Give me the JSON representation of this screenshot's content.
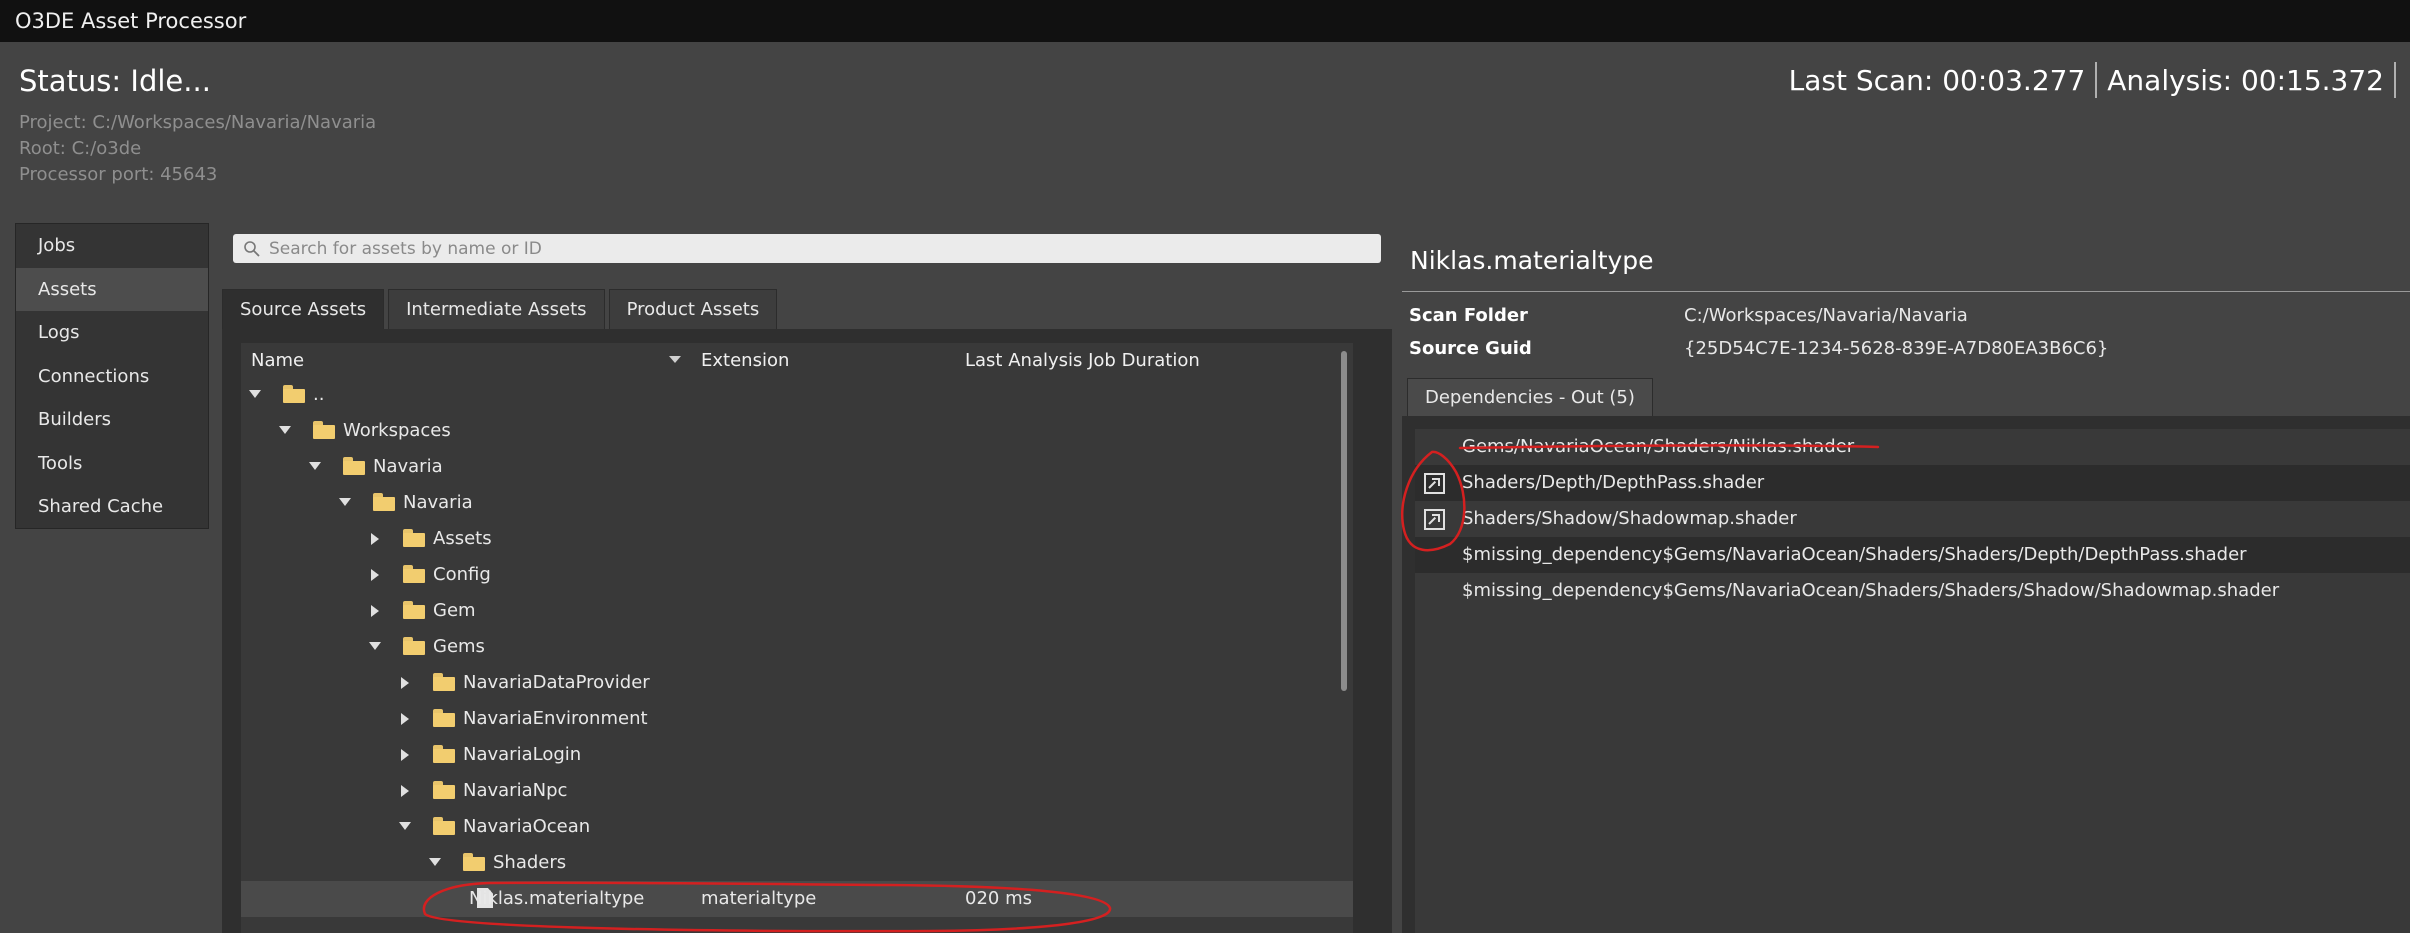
{
  "window": {
    "title": "O3DE Asset Processor"
  },
  "header": {
    "status": "Status: Idle...",
    "project": "Project: C:/Workspaces/Navaria/Navaria",
    "root": "Root: C:/o3de",
    "port": "Processor port: 45643",
    "last_scan": "Last Scan: 00:03.277",
    "analysis": "Analysis: 00:15.372"
  },
  "nav": {
    "items": [
      {
        "label": "Jobs"
      },
      {
        "label": "Assets"
      },
      {
        "label": "Logs"
      },
      {
        "label": "Connections"
      },
      {
        "label": "Builders"
      },
      {
        "label": "Tools"
      },
      {
        "label": "Shared Cache"
      }
    ],
    "active": "Assets"
  },
  "search": {
    "placeholder": "Search for assets by name or ID"
  },
  "tabs": [
    {
      "label": "Source Assets"
    },
    {
      "label": "Intermediate Assets"
    },
    {
      "label": "Product Assets"
    }
  ],
  "tree": {
    "columns": {
      "name": "Name",
      "extension": "Extension",
      "duration": "Last Analysis Job Duration"
    },
    "rows": [
      {
        "label": "..",
        "depth": 0,
        "expanded": true,
        "type": "folder"
      },
      {
        "label": "Workspaces",
        "depth": 1,
        "expanded": true,
        "type": "folder"
      },
      {
        "label": "Navaria",
        "depth": 2,
        "expanded": true,
        "type": "folder"
      },
      {
        "label": "Navaria",
        "depth": 3,
        "expanded": true,
        "type": "folder"
      },
      {
        "label": "Assets",
        "depth": 4,
        "expanded": false,
        "type": "folder"
      },
      {
        "label": "Config",
        "depth": 4,
        "expanded": false,
        "type": "folder"
      },
      {
        "label": "Gem",
        "depth": 4,
        "expanded": false,
        "type": "folder"
      },
      {
        "label": "Gems",
        "depth": 4,
        "expanded": true,
        "type": "folder"
      },
      {
        "label": "NavariaDataProvider",
        "depth": 5,
        "expanded": false,
        "type": "folder"
      },
      {
        "label": "NavariaEnvironment",
        "depth": 5,
        "expanded": false,
        "type": "folder"
      },
      {
        "label": "NavariaLogin",
        "depth": 5,
        "expanded": false,
        "type": "folder"
      },
      {
        "label": "NavariaNpc",
        "depth": 5,
        "expanded": false,
        "type": "folder"
      },
      {
        "label": "NavariaOcean",
        "depth": 5,
        "expanded": true,
        "type": "folder"
      },
      {
        "label": "Shaders",
        "depth": 6,
        "expanded": true,
        "type": "folder"
      },
      {
        "label": "Niklas.materialtype",
        "depth": 7,
        "type": "file",
        "extension": "materialtype",
        "duration": "020 ms",
        "selected": true
      }
    ]
  },
  "details": {
    "title": "Niklas.materialtype",
    "scan_folder_label": "Scan Folder",
    "scan_folder_value": "C:/Workspaces/Navaria/Navaria",
    "source_guid_label": "Source Guid",
    "source_guid_value": "{25D54C7E-1234-5628-839E-A7D80EA3B6C6}",
    "dependencies_tab": "Dependencies - Out (5)",
    "dependencies": [
      {
        "label": "Gems/NavariaOcean/Shaders/Niklas.shader",
        "goto_icon": false
      },
      {
        "label": "Shaders/Depth/DepthPass.shader",
        "goto_icon": true
      },
      {
        "label": "Shaders/Shadow/Shadowmap.shader",
        "goto_icon": true
      },
      {
        "label": "$missing_dependency$Gems/NavariaOcean/Shaders/Shaders/Depth/DepthPass.shader",
        "goto_icon": false
      },
      {
        "label": "$missing_dependency$Gems/NavariaOcean/Shaders/Shaders/Shadow/Shadowmap.shader",
        "goto_icon": false
      }
    ]
  },
  "annotation_color": "#d42020"
}
